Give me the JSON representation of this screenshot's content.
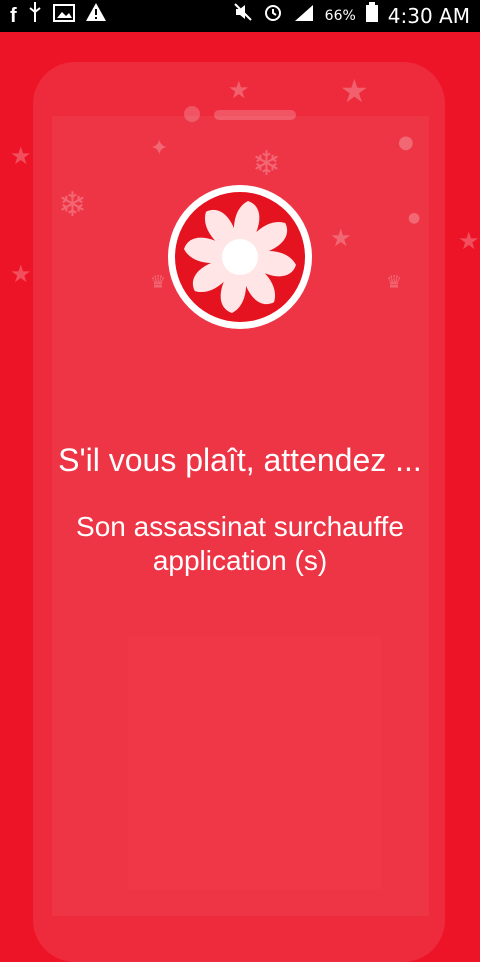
{
  "status_bar": {
    "icons": [
      "facebook-icon",
      "usb-icon",
      "image-icon",
      "warning-icon"
    ],
    "right_icons": [
      "mute-icon",
      "alarm-icon",
      "signal-icon"
    ],
    "battery": "66%",
    "time": "4:30 AM"
  },
  "main": {
    "title": "S'il vous plaît, attendez ...",
    "subtitle": "Son assassinat surchauffe application (s)"
  },
  "colors": {
    "background": "#ed1427",
    "icon_circle": "#ffffff",
    "blade": "#ffe5e5"
  }
}
